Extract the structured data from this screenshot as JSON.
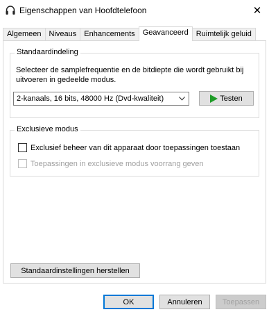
{
  "window": {
    "title": "Eigenschappen van Hoofdtelefoon",
    "close_glyph": "✕"
  },
  "tabs": [
    {
      "label": "Algemeen",
      "active": false
    },
    {
      "label": "Niveaus",
      "active": false
    },
    {
      "label": "Enhancements",
      "active": false
    },
    {
      "label": "Geavanceerd",
      "active": true
    },
    {
      "label": "Ruimtelijk geluid",
      "active": false
    }
  ],
  "default_format": {
    "legend": "Standaardindeling",
    "description": "Selecteer de samplefrequentie en de bitdiepte die wordt gebruikt bij uitvoeren in gedeelde modus.",
    "selected_value": "2-kanaals, 16 bits, 48000 Hz (Dvd-kwaliteit)",
    "test_label": "Testen",
    "test_icon": "play-icon"
  },
  "exclusive_mode": {
    "legend": "Exclusieve modus",
    "option_1_label": "Exclusief beheer van dit apparaat door toepassingen toestaan",
    "option_1_checked": false,
    "option_2_label": "Toepassingen in exclusieve modus voorrang geven",
    "option_2_checked": false,
    "option_2_disabled": true
  },
  "reset_label": "Standaardinstellingen herstellen",
  "footer": {
    "ok_label": "OK",
    "cancel_label": "Annuleren",
    "apply_label": "Toepassen"
  },
  "colors": {
    "accent": "#0078d7",
    "play_green": "#1e9b27"
  }
}
